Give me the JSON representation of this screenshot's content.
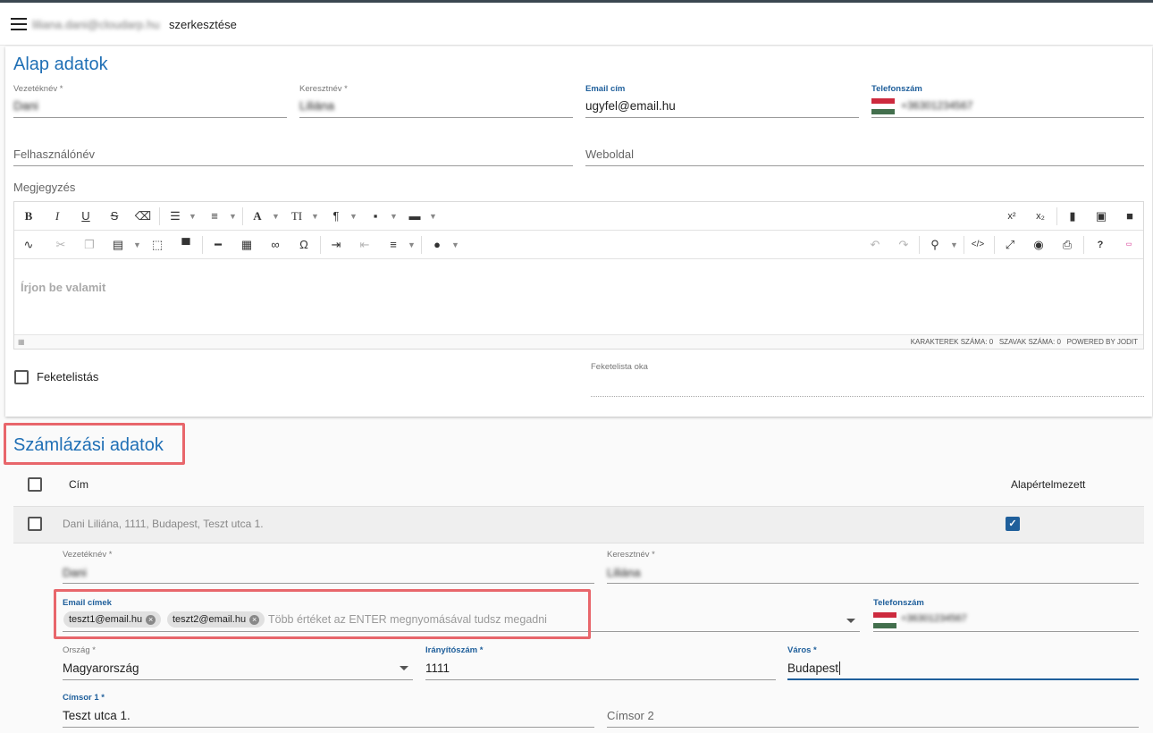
{
  "header": {
    "user_email": "liliana.dani@cloudarp.hu",
    "title_suffix": "szerkesztése"
  },
  "basic": {
    "title": "Alap adatok",
    "last_name": {
      "label": "Vezetéknév *",
      "value": "Dani"
    },
    "first_name": {
      "label": "Keresztnév *",
      "value": "Liliána"
    },
    "email": {
      "label": "Email cím",
      "value": "ugyfel@email.hu"
    },
    "phone": {
      "label": "Telefonszám",
      "value": "+36301234567"
    },
    "username": {
      "placeholder": "Felhasználónév"
    },
    "website": {
      "placeholder": "Weboldal"
    },
    "note_label": "Megjegyzés",
    "editor": {
      "placeholder": "Írjon be valamit",
      "char_count": "KARAKTEREK SZÁMA: 0",
      "word_count": "SZAVAK SZÁMA: 0",
      "powered": "POWERED BY JODIT"
    },
    "blacklist_label": "Feketelistás",
    "blacklist_reason_label": "Feketelista oka"
  },
  "billing": {
    "title": "Számlázási adatok",
    "col_address": "Cím",
    "col_default": "Alapértelmezett",
    "row_address": "Dani Liliána, 1111, Budapest, Teszt utca 1.",
    "last_name": {
      "label": "Vezetéknév *",
      "value": "Dani"
    },
    "first_name": {
      "label": "Keresztnév *",
      "value": "Liliána"
    },
    "emails_label": "Email címek",
    "emails": [
      "teszt1@email.hu",
      "teszt2@email.hu"
    ],
    "emails_placeholder": "Több értéket az ENTER megnyomásával tudsz megadni",
    "phone": {
      "label": "Telefonszám",
      "value": "+36301234567"
    },
    "country": {
      "label": "Ország *",
      "value": "Magyarország"
    },
    "zip": {
      "label": "Irányítószám *",
      "value": "1111"
    },
    "city": {
      "label": "Város *",
      "value": "Budapest"
    },
    "address1": {
      "label": "Címsor 1 *",
      "value": "Teszt utca 1."
    },
    "address2": {
      "placeholder": "Címsor 2"
    }
  },
  "colors": {
    "accent": "#1f6fb5",
    "highlight": "#e8666b",
    "flag_red": "#cd2a3e",
    "flag_green": "#436f4d"
  }
}
